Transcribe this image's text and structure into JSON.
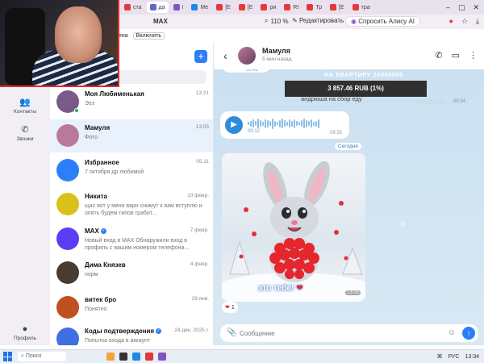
{
  "browser": {
    "tabs": [
      {
        "label": "ста",
        "color": "#e53935"
      },
      {
        "label": "да",
        "color": "#5c6bc0"
      },
      {
        "label": "I",
        "color": "#7e57c2"
      },
      {
        "label": "Me",
        "color": "#1e88e5"
      },
      {
        "label": "[Е",
        "color": "#e53935"
      },
      {
        "label": "[Е",
        "color": "#e53935"
      },
      {
        "label": "ри",
        "color": "#e53935"
      },
      {
        "label": "RI",
        "color": "#e53935"
      },
      {
        "label": "Тр",
        "color": "#e53935"
      },
      {
        "label": "[Е",
        "color": "#e53935"
      },
      {
        "label": "тра",
        "color": "#e53935"
      }
    ],
    "page_title": "MAX",
    "zoom": "110 %",
    "edit_label": "Редактировать",
    "alice_label": "Спросить Алису AI",
    "subbar_left": "ена",
    "subbar_enable": "Включить"
  },
  "rail": {
    "contacts": "Контакты",
    "calls": "Звонки",
    "profile": "Профиль"
  },
  "chats": [
    {
      "name": "Моя Любименькая",
      "time": "13:21",
      "preview": "Эээ",
      "avatar_color": "#7a5a8a",
      "online": true
    },
    {
      "name": "Мамуля",
      "time": "13:05",
      "preview": "Фото",
      "avatar_color": "#b97a9a",
      "selected": true
    },
    {
      "name": "Избранное",
      "time": "05.11",
      "preview": "7 октября др любимой",
      "avatar_color": "#2d7ff9"
    },
    {
      "name": "Никита",
      "time": "10 февр.",
      "preview": "щас вот у меня варн снимут к вам вступлю и опять будем типов грабит...",
      "avatar_color": "#d8c21a"
    },
    {
      "name": "MAX",
      "time": "7 февр.",
      "preview": "Новый вход в MAX Обнаружили вход в профиль с вашим номером телефона...",
      "avatar_color": "#5b3df5",
      "verified": true
    },
    {
      "name": "Дима Князев",
      "time": "4 февр.",
      "preview": "норм",
      "avatar_color": "#4a3b30"
    },
    {
      "name": "витек бро",
      "time": "29 янв.",
      "preview": "Понятно",
      "avatar_color": "#c0501e"
    },
    {
      "name": "Коды подтверждения",
      "time": "24 дек. 2025 г.",
      "preview": "Попытка входа в аккаунт",
      "avatar_color": "#3f6fe0",
      "verified": true
    }
  ],
  "conversation": {
    "name": "Мамуля",
    "status": "5 мин назад",
    "voice1_time": "00:42",
    "donation": "3 857.46 RUB (1%)",
    "overlay_top": "НА КВАРТИРУ 20000000",
    "overlay_mid": "андрюша на сбор еду",
    "overlay_right": "10 000 000",
    "overlay_small_time": "09:34",
    "voice2_duration": "00:12",
    "voice2_time": "09:35",
    "date_chip": "Сегодня",
    "photo_caption": "это тебе!",
    "photo_time": "13:05",
    "reaction_count": "1",
    "composer_placeholder": "Сообщение"
  },
  "taskbar": {
    "search": "Поиск",
    "lang": "РУС",
    "time": "13:34"
  }
}
